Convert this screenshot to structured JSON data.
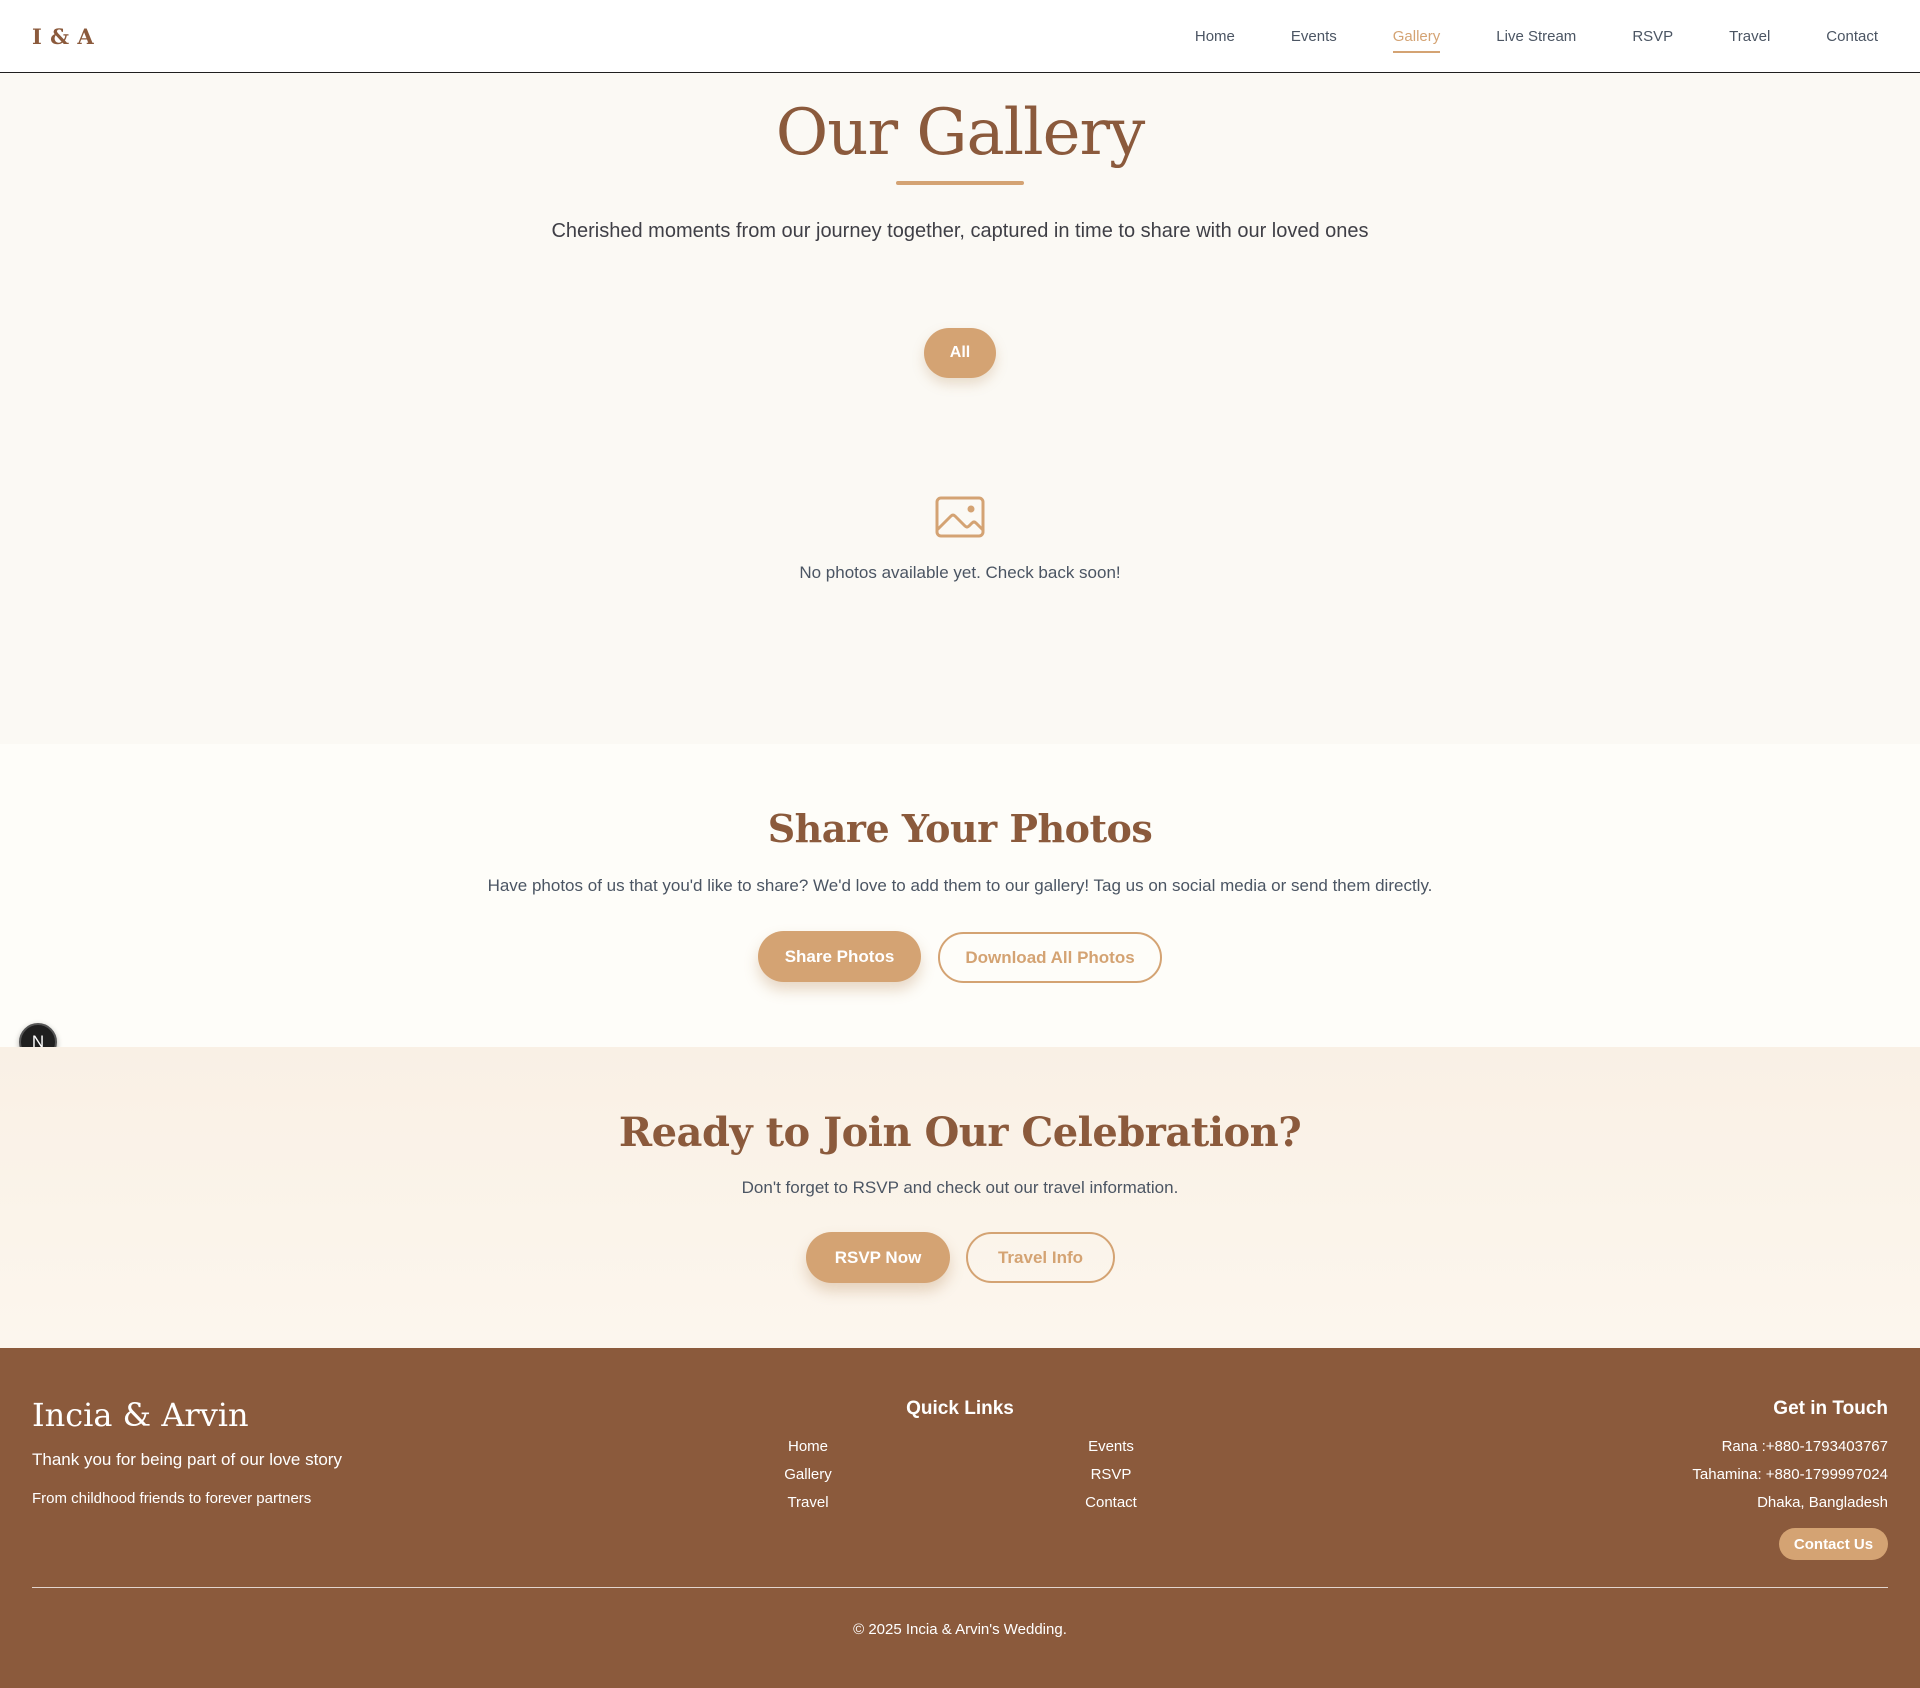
{
  "nav": {
    "brand": "I & A",
    "links": [
      {
        "label": "Home"
      },
      {
        "label": "Events"
      },
      {
        "label": "Gallery",
        "active": true
      },
      {
        "label": "Live Stream"
      },
      {
        "label": "RSVP"
      },
      {
        "label": "Travel"
      },
      {
        "label": "Contact"
      }
    ]
  },
  "gallery": {
    "title": "Our Gallery",
    "subtitle": "Cherished moments from our journey together, captured in time to share with our loved ones",
    "filter_label": "All",
    "empty_icon": "image-icon",
    "empty_text": "No photos available yet. Check back soon!"
  },
  "share": {
    "title": "Share Your Photos",
    "text": "Have photos of us that you'd like to share? We'd love to add them to our gallery! Tag us on social media or send them directly.",
    "share_button": "Share Photos",
    "download_button": "Download All Photos"
  },
  "badge": {
    "letter": "N"
  },
  "cta": {
    "title": "Ready to Join Our Celebration?",
    "text": "Don't forget to RSVP and check out our travel information.",
    "rsvp_button": "RSVP Now",
    "travel_button": "Travel Info"
  },
  "footer": {
    "brand": "Incia & Arvin",
    "tagline": "Thank you for being part of our love story",
    "small": "From childhood friends to forever partners",
    "quick_links_title": "Quick Links",
    "quick_links": [
      "Home",
      "Events",
      "Gallery",
      "RSVP",
      "Travel",
      "Contact"
    ],
    "contact_title": "Get in Touch",
    "contacts": [
      "Rana :+880-1793403767",
      "Tahamina: +880-1799997024",
      "Dhaka, Bangladesh"
    ],
    "contact_button": "Contact Us",
    "copyright": "© 2025 Incia & Arvin's Wedding."
  },
  "colors": {
    "accent": "#d4a373",
    "brown": "#8b5a3c",
    "background": "#fbf9f4"
  }
}
